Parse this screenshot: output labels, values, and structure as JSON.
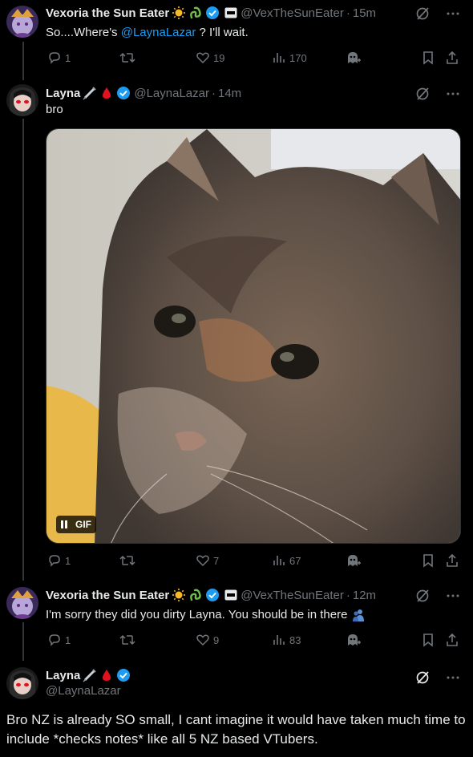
{
  "tweets": [
    {
      "name": "Vexoria the Sun Eater",
      "handle": "@VexTheSunEater",
      "time": "15m",
      "text_before": "So....Where's ",
      "mention": "@LaynaLazar",
      "text_after": " ? I'll wait.",
      "replies": "1",
      "reposts": "",
      "likes": "19",
      "views": "170"
    },
    {
      "name": "Layna",
      "handle": "@LaynaLazar",
      "time": "14m",
      "text": "bro",
      "gif_label": "GIF",
      "replies": "1",
      "reposts": "",
      "likes": "7",
      "views": "67"
    },
    {
      "name": "Vexoria the Sun Eater",
      "handle": "@VexTheSunEater",
      "time": "12m",
      "text": "I'm sorry they did you dirty Layna. You should be in there",
      "replies": "1",
      "reposts": "",
      "likes": "9",
      "views": "83"
    },
    {
      "name": "Layna",
      "handle": "@LaynaLazar",
      "text": "Bro NZ is already SO small, I cant imagine it would have taken much time to include *checks notes* like all 5 NZ based VTubers."
    }
  ],
  "colors": {
    "accent": "#1d9bf0",
    "muted": "#71767b",
    "text": "#e7e9ea",
    "line": "#333639"
  },
  "icons": [
    "sun-icon",
    "snake-icon",
    "verified-badge-icon",
    "affiliate-badge-icon",
    "syringe-icon",
    "blood-drop-icon",
    "grok-icon",
    "more-icon",
    "reply-icon",
    "repost-icon",
    "like-icon",
    "views-icon",
    "bookmark-icon",
    "share-icon",
    "ghost-icon",
    "pause-icon"
  ]
}
